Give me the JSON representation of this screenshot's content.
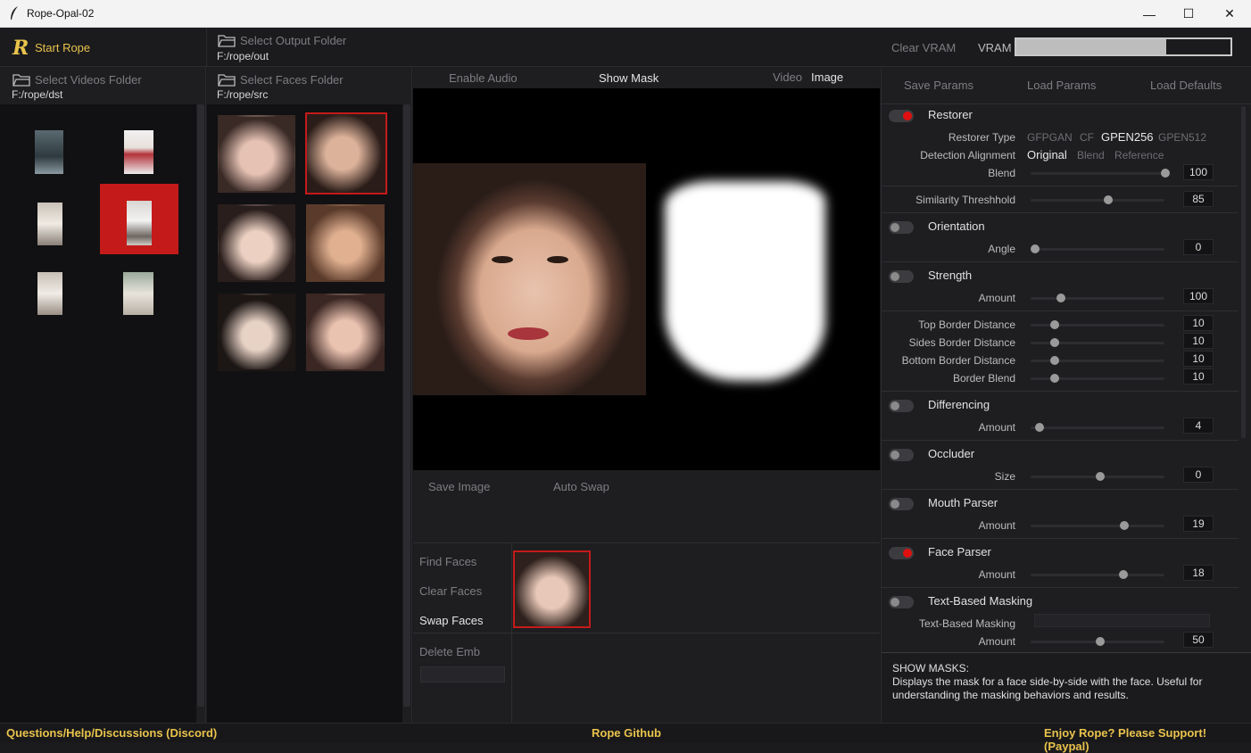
{
  "window": {
    "title": "Rope-Opal-02",
    "minimize": "—",
    "maximize": "☐",
    "close": "✕"
  },
  "top": {
    "start_rope": "Start Rope",
    "select_output": "Select Output Folder",
    "output_path": "F:/rope/out",
    "clear_vram": "Clear VRAM",
    "vram_label": "VRAM",
    "vram_used_fraction": 0.7
  },
  "videos": {
    "header": "Select Videos Folder",
    "path": "F:/rope/dst"
  },
  "faces": {
    "header": "Select Faces Folder",
    "path": "F:/rope/src"
  },
  "viewer": {
    "enable_audio": "Enable Audio",
    "show_mask": "Show Mask",
    "video": "Video",
    "image": "Image",
    "save_image": "Save Image",
    "auto_swap": "Auto Swap"
  },
  "face_controls": {
    "find_faces": "Find Faces",
    "clear_faces": "Clear Faces",
    "swap_faces": "Swap Faces",
    "delete_emb": "Delete Emb"
  },
  "params_top": {
    "save": "Save Params",
    "load": "Load Params",
    "defaults": "Load Defaults"
  },
  "params": {
    "restorer": {
      "title": "Restorer",
      "type_label": "Restorer Type",
      "types": [
        "GFPGAN",
        "CF",
        "GPEN256",
        "GPEN512"
      ],
      "align_label": "Detection Alignment",
      "aligns": [
        "Original",
        "Blend",
        "Reference"
      ],
      "blend_label": "Blend",
      "blend": "100"
    },
    "similarity": {
      "label": "Similarity Threshhold",
      "value": "85"
    },
    "orientation": {
      "title": "Orientation",
      "label": "Angle",
      "value": "0"
    },
    "strength": {
      "title": "Strength",
      "label": "Amount",
      "value": "100"
    },
    "border": {
      "top_label": "Top Border Distance",
      "top": "10",
      "sides_label": "Sides Border Distance",
      "sides": "10",
      "bottom_label": "Bottom Border Distance",
      "bottom": "10",
      "blend_label": "Border Blend",
      "blend": "10"
    },
    "differencing": {
      "title": "Differencing",
      "label": "Amount",
      "value": "4"
    },
    "occluder": {
      "title": "Occluder",
      "label": "Size",
      "value": "0"
    },
    "mouth": {
      "title": "Mouth Parser",
      "label": "Amount",
      "value": "19"
    },
    "faceparser": {
      "title": "Face Parser",
      "label": "Amount",
      "value": "18"
    },
    "textmask": {
      "title": "Text-Based Masking",
      "text_label": "Text-Based Masking",
      "label": "Amount",
      "value": "50"
    }
  },
  "help": {
    "title": "SHOW MASKS:",
    "body": "Displays the mask for a face side-by-side with the face. Useful for understanding the masking behaviors and results."
  },
  "bottom": {
    "discord": "Questions/Help/Discussions (Discord)",
    "github": "Rope Github",
    "paypal": "Enjoy Rope? Please Support! (Paypal)"
  },
  "colors": {
    "accent": "#c41a1a",
    "yellow": "#e9c34b"
  }
}
